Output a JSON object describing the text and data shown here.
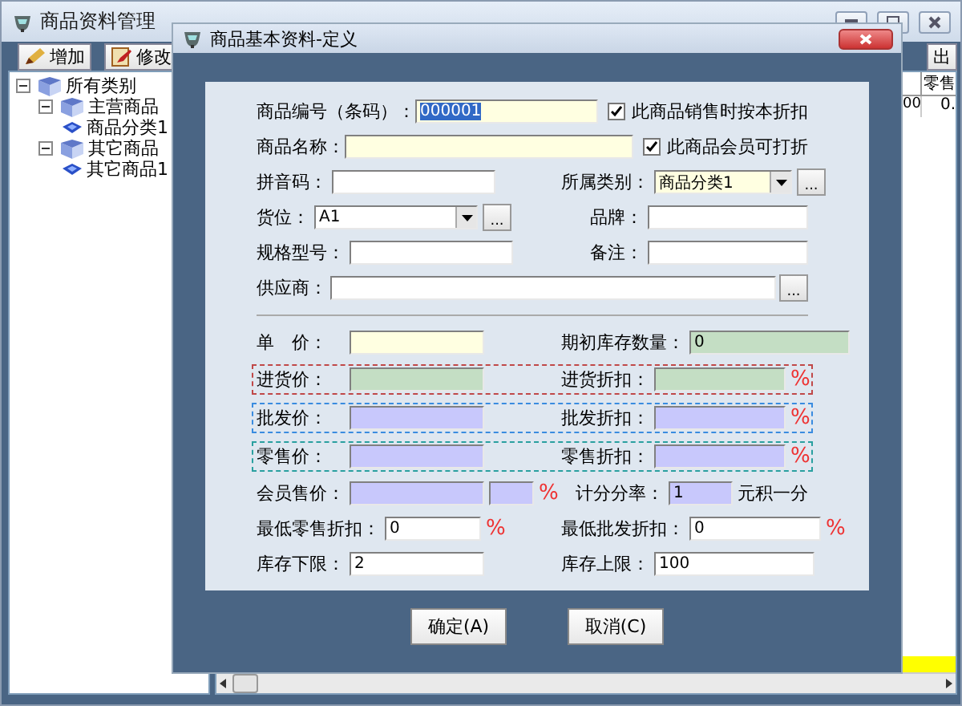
{
  "window": {
    "title": "商品资料管理"
  },
  "toolbar": [
    {
      "label": "增加"
    },
    {
      "label": "修改"
    },
    {
      "label": "出"
    }
  ],
  "tree": [
    {
      "label": "所有类别",
      "expanded": true,
      "children": [
        {
          "label": "主营商品",
          "expanded": true,
          "children": [
            {
              "label": "商品分类1"
            }
          ]
        },
        {
          "label": "其它商品",
          "expanded": true,
          "children": [
            {
              "label": "其它商品1"
            }
          ]
        }
      ]
    }
  ],
  "table": {
    "header": "零售",
    "rows": [
      {
        "cells": [
          "00",
          "0."
        ]
      }
    ]
  },
  "dialog": {
    "title": "商品基本资料-定义",
    "rows": [
      {
        "kind": "check",
        "label": "商品编号（条码）：",
        "field": {
          "kind": "text",
          "value": "000001",
          "color": "#ffffe1",
          "text_selected": true
        },
        "checkbox": {
          "label": "此商品销售时按本折扣",
          "checked": true
        }
      },
      {
        "kind": "check",
        "label": "商品名称：",
        "field": {
          "kind": "text",
          "color": "#ffffe1"
        },
        "checkbox": {
          "label": "此商品会员可打折",
          "checked": true
        }
      },
      {
        "kind": "pair",
        "left": {
          "label": "拼音码：",
          "fields": [
            {
              "kind": "text",
              "color": "#ffffff"
            }
          ]
        },
        "right": {
          "label": "所属类别：",
          "fields": [
            {
              "kind": "combo",
              "value": "商品分类1",
              "color": "#ffffe1"
            },
            {
              "kind": "more",
              "label": "..."
            }
          ]
        }
      },
      {
        "kind": "pair",
        "left": {
          "label": "货位：",
          "fields": [
            {
              "kind": "combo",
              "value": "A1",
              "color": "#ffffff"
            },
            {
              "kind": "more",
              "label": "..."
            }
          ]
        },
        "right": {
          "label": "品牌：",
          "fields": [
            {
              "kind": "text",
              "color": "#ffffff"
            }
          ]
        }
      },
      {
        "kind": "pair",
        "left": {
          "label": "规格型号：",
          "fields": [
            {
              "kind": "text",
              "color": "#ffffff"
            }
          ]
        },
        "right": {
          "label": "备注：",
          "fields": [
            {
              "kind": "text",
              "color": "#ffffff"
            }
          ]
        }
      },
      {
        "kind": "wide",
        "label": "供应商：",
        "fields": [
          {
            "kind": "text",
            "color": "#ffffff"
          },
          {
            "kind": "more",
            "label": "..."
          }
        ]
      },
      {
        "kind": "price",
        "left": {
          "label": "单　价：",
          "fields": [
            {
              "kind": "text",
              "color": "#ffffe1"
            }
          ]
        },
        "right": {
          "label": "期初库存数量：",
          "fields": [
            {
              "kind": "text",
              "value": "0",
              "color": "#c4dec4"
            }
          ]
        }
      },
      {
        "kind": "price",
        "color": "#c04848",
        "left": {
          "label": "进货价：",
          "fields": [
            {
              "kind": "text",
              "color": "#c4dec4"
            }
          ]
        },
        "right": {
          "label": "进货折扣：",
          "fields": [
            {
              "kind": "text",
              "color": "#c4dec4"
            },
            {
              "kind": "suffix",
              "text": "%"
            }
          ]
        }
      },
      {
        "kind": "price",
        "color": "#3a8ce0",
        "left": {
          "label": "批发价：",
          "fields": [
            {
              "kind": "text",
              "color": "#c8c8fc"
            }
          ]
        },
        "right": {
          "label": "批发折扣：",
          "fields": [
            {
              "kind": "text",
              "color": "#c8c8fc"
            },
            {
              "kind": "suffix",
              "text": "%"
            }
          ]
        }
      },
      {
        "kind": "price",
        "color": "#2aa0a0",
        "left": {
          "label": "零售价：",
          "fields": [
            {
              "kind": "text",
              "color": "#c8c8fc"
            }
          ]
        },
        "right": {
          "label": "零售折扣：",
          "fields": [
            {
              "kind": "text",
              "color": "#c8c8fc"
            },
            {
              "kind": "suffix",
              "text": "%"
            }
          ]
        }
      },
      {
        "kind": "price",
        "left": {
          "label": "会员售价：",
          "fields": [
            {
              "kind": "text",
              "color": "#c8c8fc"
            },
            {
              "kind": "small",
              "color": "#c8c8fc"
            },
            {
              "kind": "suffix",
              "text": "%"
            }
          ]
        },
        "right": {
          "label": "计分分率：",
          "fields": [
            {
              "kind": "text",
              "value": "1",
              "color": "#c8c8fc"
            },
            {
              "kind": "note",
              "text": "元积一分"
            }
          ]
        }
      },
      {
        "kind": "price",
        "left": {
          "label": "最低零售折扣：",
          "fields": [
            {
              "kind": "text",
              "value": "0",
              "color": "#ffffff"
            },
            {
              "kind": "suffix",
              "text": "%"
            }
          ]
        },
        "right": {
          "label": "最低批发折扣：",
          "fields": [
            {
              "kind": "text",
              "value": "0",
              "color": "#ffffff"
            },
            {
              "kind": "suffix",
              "text": "%"
            }
          ]
        }
      },
      {
        "kind": "price",
        "left": {
          "label": "库存下限：",
          "fields": [
            {
              "kind": "text",
              "value": "2",
              "color": "#ffffff"
            }
          ]
        },
        "right": {
          "label": "库存上限：",
          "fields": [
            {
              "kind": "text",
              "value": "100",
              "color": "#ffffff"
            }
          ]
        }
      }
    ],
    "buttons": [
      "确定(A)",
      "取消(C)"
    ]
  }
}
